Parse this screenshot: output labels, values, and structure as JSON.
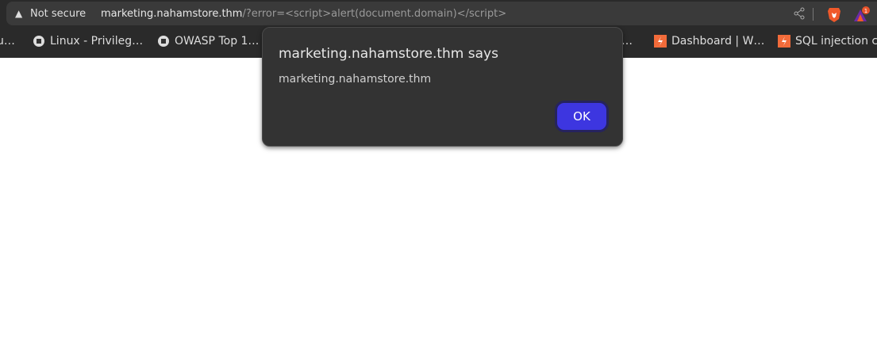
{
  "browser": {
    "security_label": "Not secure",
    "url_host": "marketing.nahamstore.thm",
    "url_rest": "/?error=<script>alert(document.domain)</script>",
    "icons": [
      "warning-icon",
      "share-icon",
      "brave-shields-icon",
      "brave-rewards-icon"
    ],
    "rewards_badge": "1"
  },
  "bookmarks": [
    {
      "label": "u…",
      "icon": ""
    },
    {
      "label": "Linux - Privileg…",
      "icon": "tryhackme-icon"
    },
    {
      "label": "OWASP Top 1…",
      "icon": "tryhackme-icon"
    },
    {
      "label": "…",
      "icon": ""
    },
    {
      "label": "Dashboard | W…",
      "icon": "portswigger-icon"
    },
    {
      "label": "SQL injection c…",
      "icon": "portswigger-icon"
    }
  ],
  "dialog": {
    "title": "marketing.nahamstore.thm says",
    "message": "marketing.nahamstore.thm",
    "ok_label": "OK",
    "accent": "#3d36e0"
  }
}
